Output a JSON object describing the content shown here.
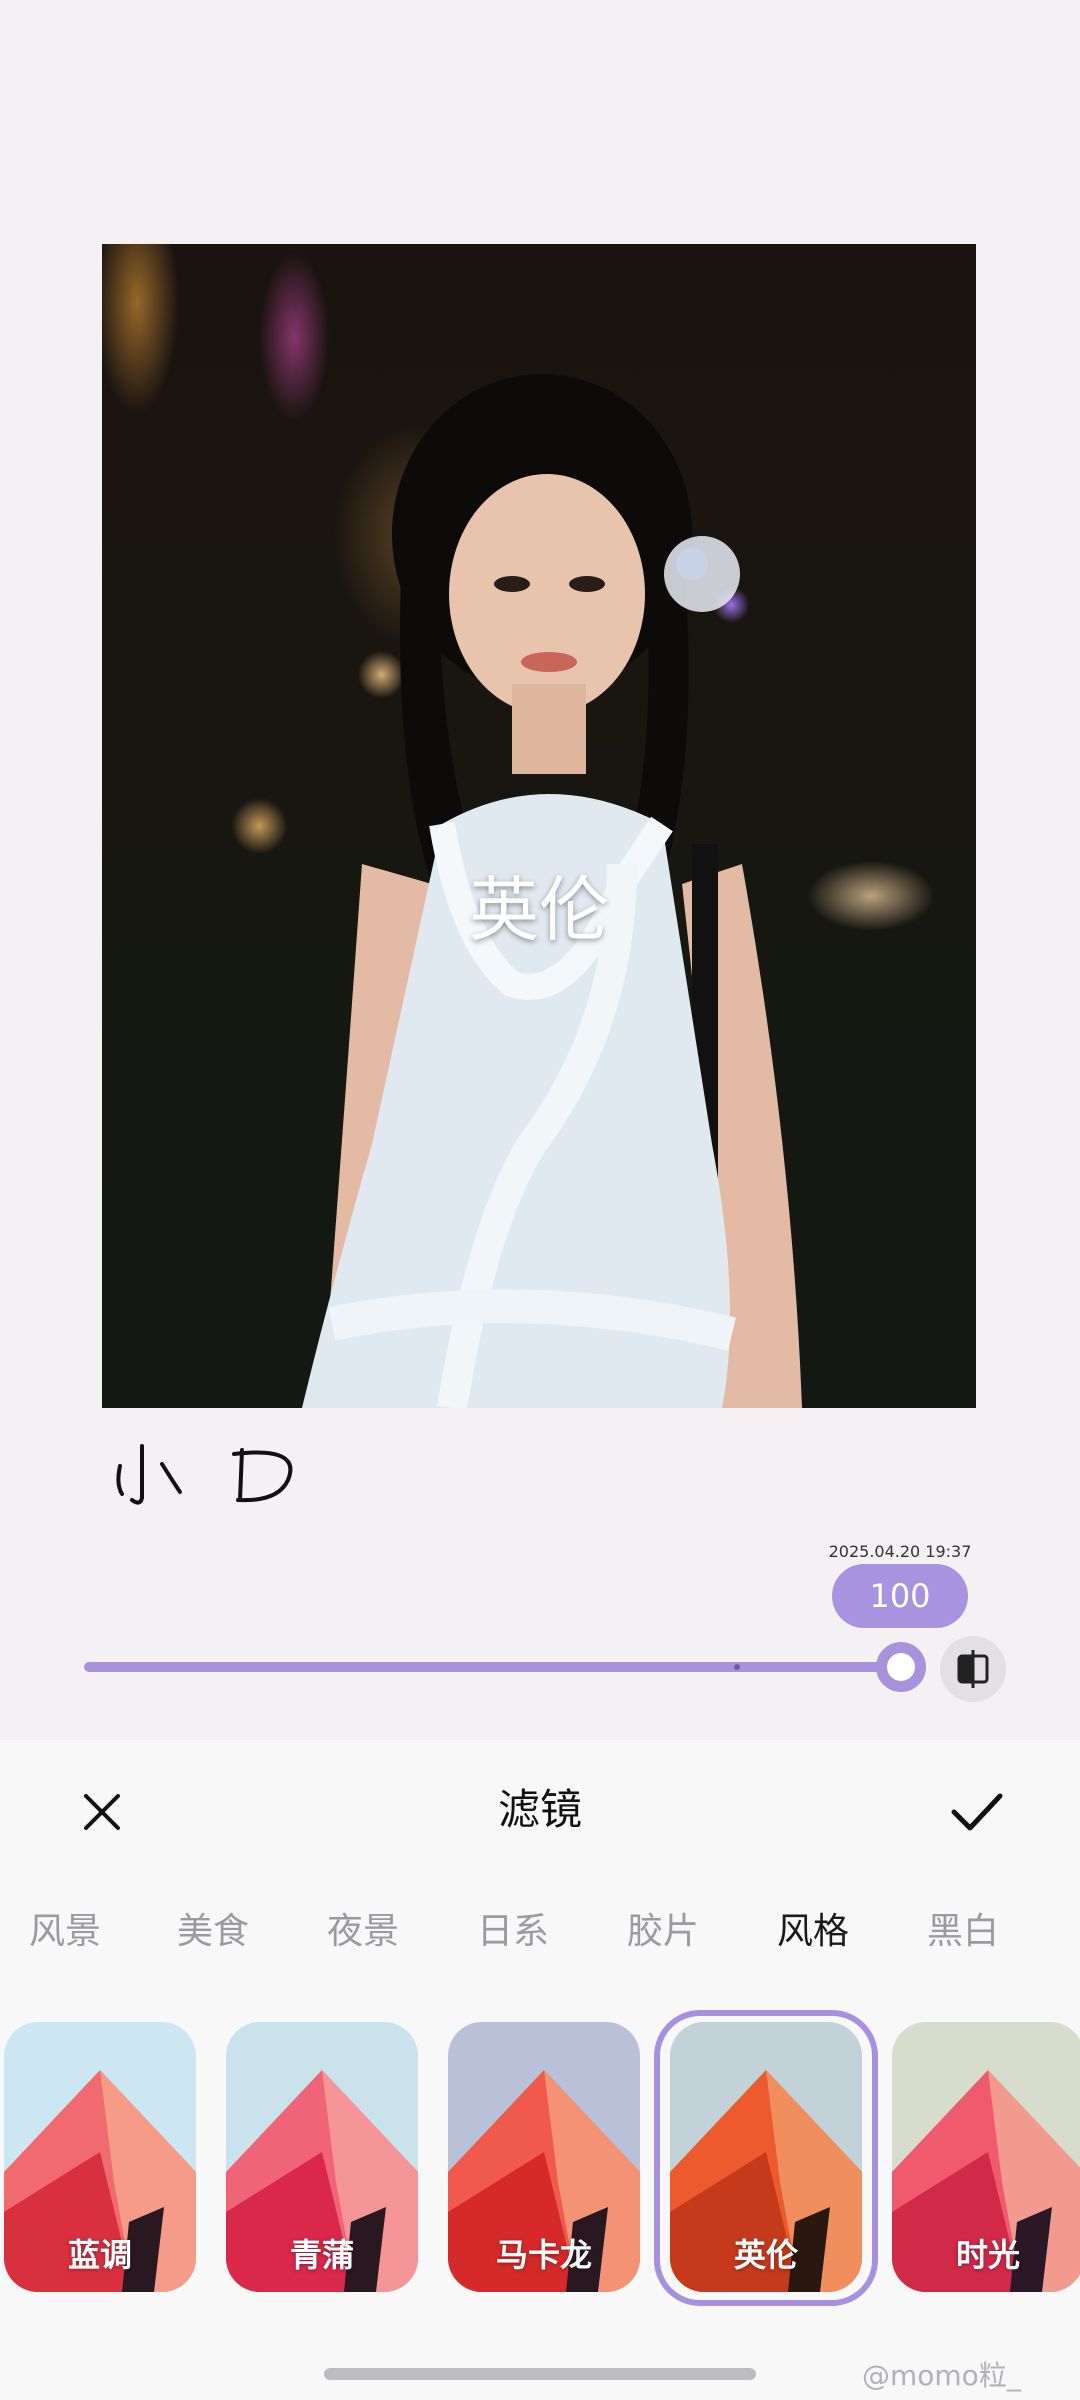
{
  "photo": {
    "overlay_label": "英伦",
    "signature": "小 D",
    "timestamp": "2025.04.20 19:37"
  },
  "slider": {
    "value": 100,
    "value_label": "100",
    "accent_color": "#a893e0"
  },
  "panel": {
    "title": "滤镜",
    "close_icon": "close-icon",
    "confirm_icon": "check-icon"
  },
  "categories": [
    {
      "label": "风景"
    },
    {
      "label": "美食"
    },
    {
      "label": "夜景"
    },
    {
      "label": "日系"
    },
    {
      "label": "胶片"
    },
    {
      "label": "风格",
      "active": true
    },
    {
      "label": "黑白"
    }
  ],
  "filters": [
    {
      "label": "蓝调"
    },
    {
      "label": "青蒲"
    },
    {
      "label": "马卡龙"
    },
    {
      "label": "英伦",
      "selected": true
    },
    {
      "label": "时光"
    }
  ],
  "watermark": "@momo粒_"
}
